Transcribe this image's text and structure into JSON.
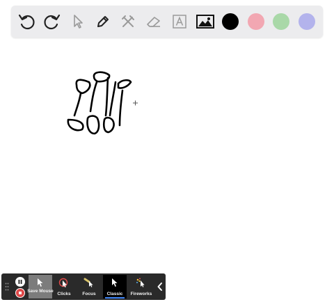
{
  "toolbar": {
    "tools": [
      "undo-icon",
      "redo-icon",
      "pointer-icon",
      "pen-icon",
      "tools-icon",
      "eraser-icon",
      "text-icon",
      "image-icon"
    ],
    "colors": [
      "#000000",
      "#f2a7b2",
      "#a9d8a8",
      "#b3b3ec"
    ]
  },
  "recorder": {
    "modes": [
      {
        "label": "Save Mouse",
        "active": true
      },
      {
        "label": "Clicks",
        "active": false
      },
      {
        "label": "Focus",
        "active": false
      },
      {
        "label": "Classic",
        "active": true
      },
      {
        "label": "Fireworks",
        "active": false
      }
    ]
  }
}
